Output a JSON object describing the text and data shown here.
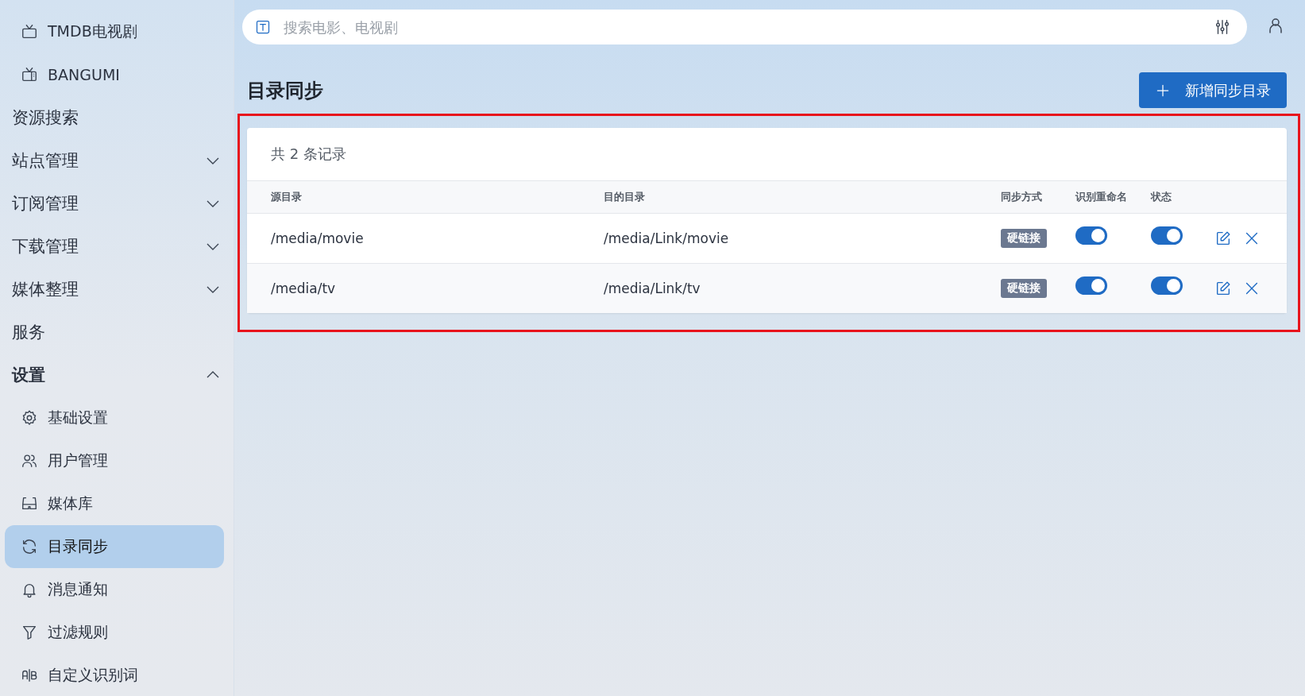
{
  "sidebar": {
    "items": [
      {
        "kind": "sub",
        "label": "TMDB电视剧",
        "selected": false
      },
      {
        "kind": "sub",
        "label": "BANGUMI",
        "selected": false
      },
      {
        "kind": "link",
        "label": "资源搜索"
      },
      {
        "kind": "group",
        "label": "站点管理",
        "expanded": false
      },
      {
        "kind": "group",
        "label": "订阅管理",
        "expanded": false
      },
      {
        "kind": "group",
        "label": "下载管理",
        "expanded": false
      },
      {
        "kind": "group",
        "label": "媒体整理",
        "expanded": false
      },
      {
        "kind": "link",
        "label": "服务"
      },
      {
        "kind": "group",
        "label": "设置",
        "expanded": true,
        "children": [
          {
            "label": "基础设置",
            "selected": false
          },
          {
            "label": "用户管理",
            "selected": false
          },
          {
            "label": "媒体库",
            "selected": false
          },
          {
            "label": "目录同步",
            "selected": true
          },
          {
            "label": "消息通知",
            "selected": false
          },
          {
            "label": "过滤规则",
            "selected": false
          },
          {
            "label": "自定义识别词",
            "selected": false
          }
        ]
      }
    ]
  },
  "search": {
    "placeholder": "搜索电影、电视剧"
  },
  "page": {
    "title": "目录同步",
    "add_button": "新增同步目录"
  },
  "table": {
    "summary": "共 2 条记录",
    "columns": [
      "源目录",
      "目的目录",
      "同步方式",
      "识别重命名",
      "状态"
    ],
    "rows": [
      {
        "source": "/media/movie",
        "target": "/media/Link/movie",
        "mode": "硬链接",
        "rename": true,
        "enabled": true
      },
      {
        "source": "/media/tv",
        "target": "/media/Link/tv",
        "mode": "硬链接",
        "rename": true,
        "enabled": true
      }
    ]
  }
}
